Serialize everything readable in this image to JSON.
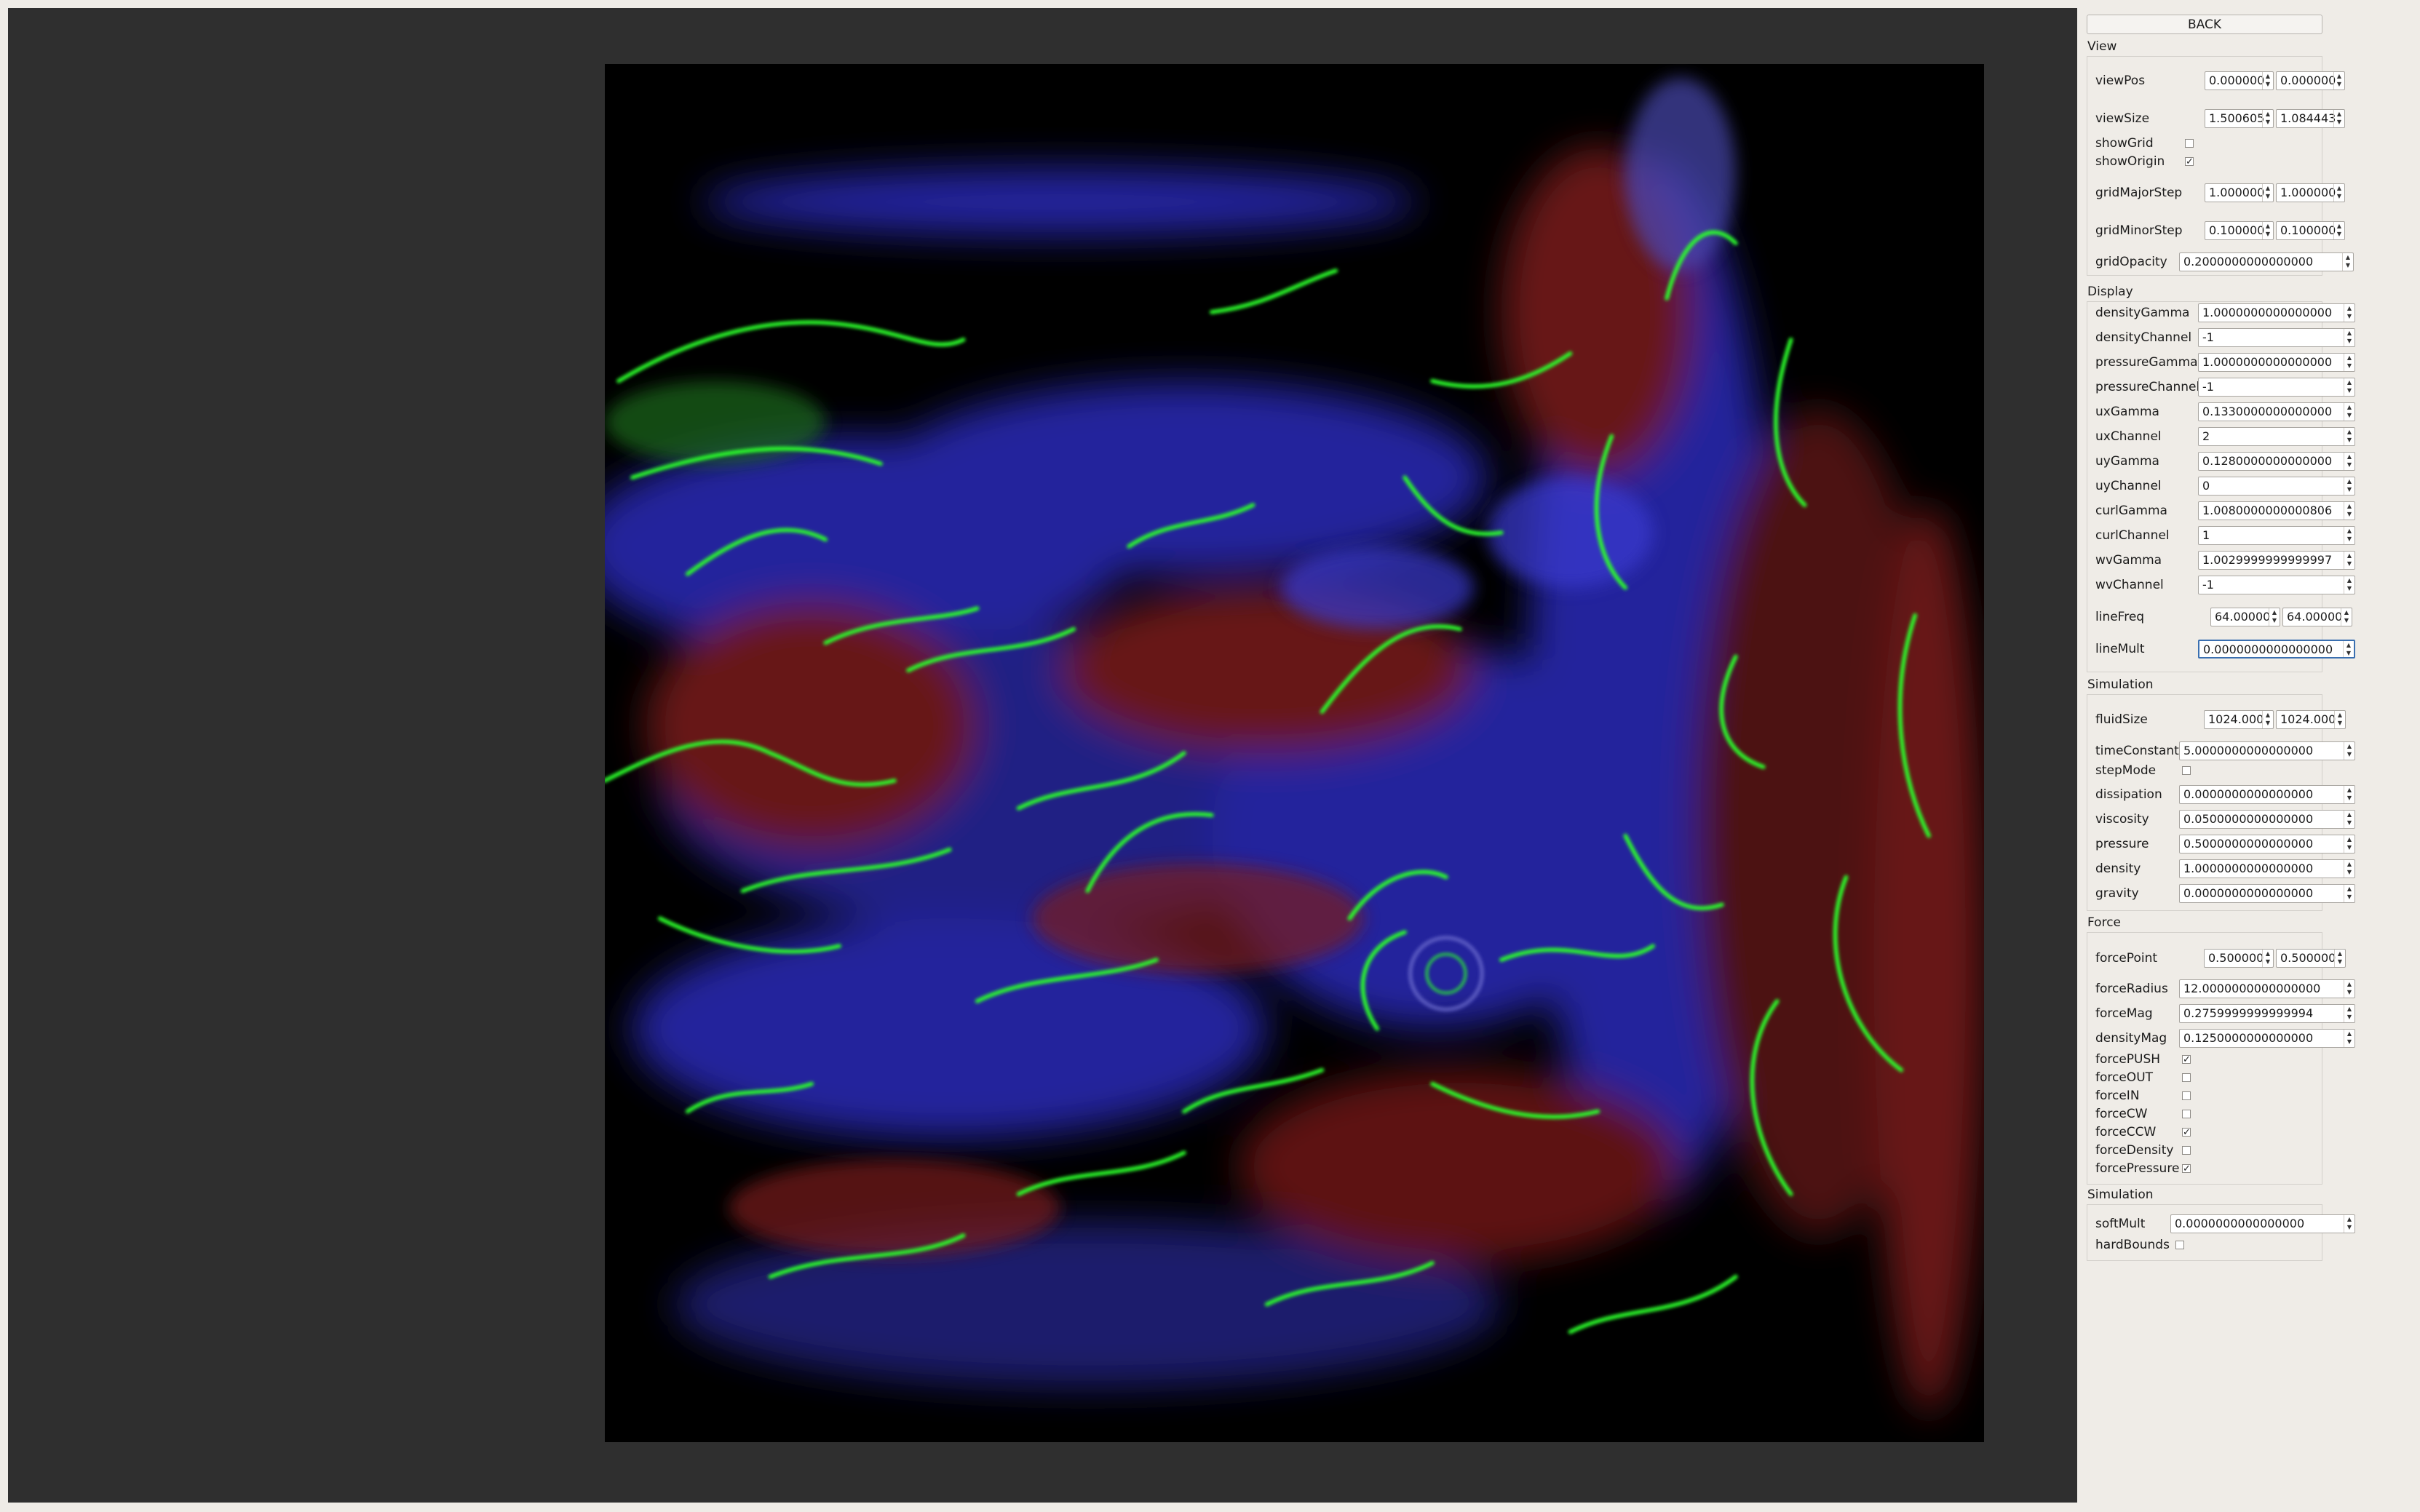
{
  "panel": {
    "back_label": "BACK",
    "sections": {
      "view": {
        "title": "View",
        "viewPos": {
          "label": "viewPos",
          "x": "0.000000",
          "y": "0.000000"
        },
        "viewSize": {
          "label": "viewSize",
          "x": "1.500605",
          "y": "1.084443"
        },
        "showGrid": {
          "label": "showGrid",
          "checked": false
        },
        "showOrigin": {
          "label": "showOrigin",
          "checked": true
        },
        "gridMajorStep": {
          "label": "gridMajorStep",
          "x": "1.000000",
          "y": "1.000000"
        },
        "gridMinorStep": {
          "label": "gridMinorStep",
          "x": "0.100000",
          "y": "0.100000"
        },
        "gridOpacity": {
          "label": "gridOpacity",
          "value": "0.2000000000000000"
        }
      },
      "display": {
        "title": "Display",
        "densityGamma": {
          "label": "densityGamma",
          "value": "1.0000000000000000"
        },
        "densityChannel": {
          "label": "densityChannel",
          "value": "-1"
        },
        "pressureGamma": {
          "label": "pressureGamma",
          "value": "1.0000000000000000"
        },
        "pressureChannel": {
          "label": "pressureChannel",
          "value": "-1"
        },
        "uxGamma": {
          "label": "uxGamma",
          "value": "0.1330000000000000"
        },
        "uxChannel": {
          "label": "uxChannel",
          "value": "2"
        },
        "uyGamma": {
          "label": "uyGamma",
          "value": "0.1280000000000000"
        },
        "uyChannel": {
          "label": "uyChannel",
          "value": "0"
        },
        "curlGamma": {
          "label": "curlGamma",
          "value": "1.0080000000000806"
        },
        "curlChannel": {
          "label": "curlChannel",
          "value": "1"
        },
        "wvGamma": {
          "label": "wvGamma",
          "value": "1.0029999999999997"
        },
        "wvChannel": {
          "label": "wvChannel",
          "value": "-1"
        },
        "lineFreq": {
          "label": "lineFreq",
          "x": "64.00000",
          "y": "64.00000"
        },
        "lineMult": {
          "label": "lineMult",
          "value": "0.0000000000000000"
        }
      },
      "simulation": {
        "title": "Simulation",
        "fluidSize": {
          "label": "fluidSize",
          "x": "1024.000",
          "y": "1024.000"
        },
        "timeConstant": {
          "label": "timeConstant",
          "value": "5.0000000000000000"
        },
        "stepMode": {
          "label": "stepMode",
          "checked": false
        },
        "dissipation": {
          "label": "dissipation",
          "value": "0.0000000000000000"
        },
        "viscosity": {
          "label": "viscosity",
          "value": "0.0500000000000000"
        },
        "pressure": {
          "label": "pressure",
          "value": "0.5000000000000000"
        },
        "density": {
          "label": "density",
          "value": "1.0000000000000000"
        },
        "gravity": {
          "label": "gravity",
          "value": "0.0000000000000000"
        }
      },
      "force": {
        "title": "Force",
        "forcePoint": {
          "label": "forcePoint",
          "x": "0.500000",
          "y": "0.500000"
        },
        "forceRadius": {
          "label": "forceRadius",
          "value": "12.0000000000000000"
        },
        "forceMag": {
          "label": "forceMag",
          "value": "0.2759999999999994"
        },
        "densityMag": {
          "label": "densityMag",
          "value": "0.1250000000000000"
        },
        "forcePUSH": {
          "label": "forcePUSH",
          "checked": true
        },
        "forceOUT": {
          "label": "forceOUT",
          "checked": false
        },
        "forceIN": {
          "label": "forceIN",
          "checked": false
        },
        "forceCW": {
          "label": "forceCW",
          "checked": false
        },
        "forceCCW": {
          "label": "forceCCW",
          "checked": true
        },
        "forceDensity": {
          "label": "forceDensity",
          "checked": false
        },
        "forcePressure": {
          "label": "forcePressure",
          "checked": true
        }
      },
      "simulation2": {
        "title": "Simulation",
        "softMult": {
          "label": "softMult",
          "value": "0.0000000000000000"
        },
        "hardBounds": {
          "label": "hardBounds",
          "checked": false
        }
      }
    }
  },
  "colors": {
    "panel_bg": "#efece7",
    "viewport_bg": "#2f2f2f",
    "canvas_bg": "#000000",
    "fluid_green": "#2cff2c",
    "fluid_blue": "#2a2ab8",
    "fluid_red": "#8a1d1d"
  },
  "canvas": {
    "content": "fluid-simulation-render"
  }
}
